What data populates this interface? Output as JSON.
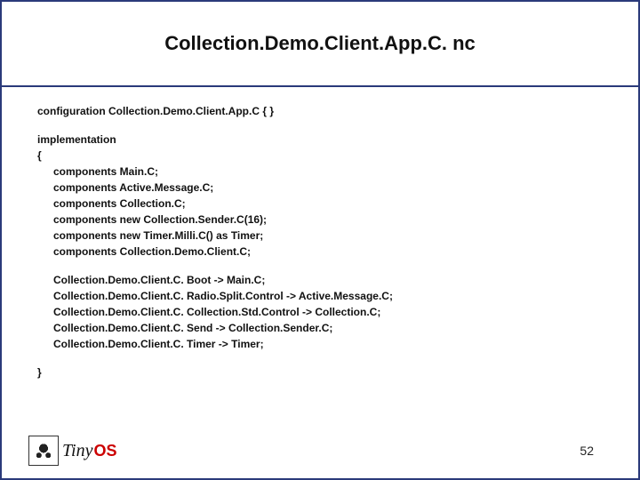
{
  "title": "Collection.Demo.Client.App.C. nc",
  "code": {
    "config_line": "configuration Collection.Demo.Client.App.C { }",
    "impl_open": "implementation",
    "brace_open": "{",
    "components": [
      "components Main.C;",
      "components Active.Message.C;",
      "components Collection.C;",
      "components new Collection.Sender.C(16);",
      "components new Timer.Milli.C() as Timer;",
      "components Collection.Demo.Client.C;"
    ],
    "wirings": [
      "Collection.Demo.Client.C. Boot -> Main.C;",
      "Collection.Demo.Client.C. Radio.Split.Control -> Active.Message.C;",
      "Collection.Demo.Client.C. Collection.Std.Control -> Collection.C;",
      "Collection.Demo.Client.C. Send -> Collection.Sender.C;",
      "Collection.Demo.Client.C. Timer -> Timer;"
    ],
    "brace_close": "}"
  },
  "logo": {
    "tiny": "Tiny",
    "os": "OS"
  },
  "page_number": "52"
}
